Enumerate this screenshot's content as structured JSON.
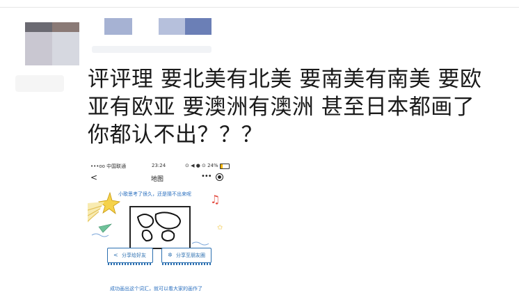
{
  "post": {
    "lines": [
      "评评理 要北美有北美 要南美有南美 要欧",
      "亚有欧亚 要澳洲有澳洲 甚至日本都画了",
      "你都认不出？？？"
    ]
  },
  "phone": {
    "status": {
      "carrier": "•••oo 中国联通",
      "time": "23:24",
      "indicators": "⊙ ◀ ● ⊙ 24%"
    },
    "nav": {
      "back": "<",
      "title": "地图",
      "more": "•••",
      "target_icon": "target-icon"
    },
    "hint": "小歌思考了很久，还是猜不出来呢",
    "share_friend": "分享给好友",
    "share_moments": "分享至朋友圈",
    "success": "成功画出这个词汇，就可以看大家的画作了"
  },
  "colors": {
    "accent_blue": "#2b6fb0",
    "hint_blue": "#2a6fbf",
    "note_red": "#e24a3f",
    "star_yellow": "#f0c030"
  }
}
